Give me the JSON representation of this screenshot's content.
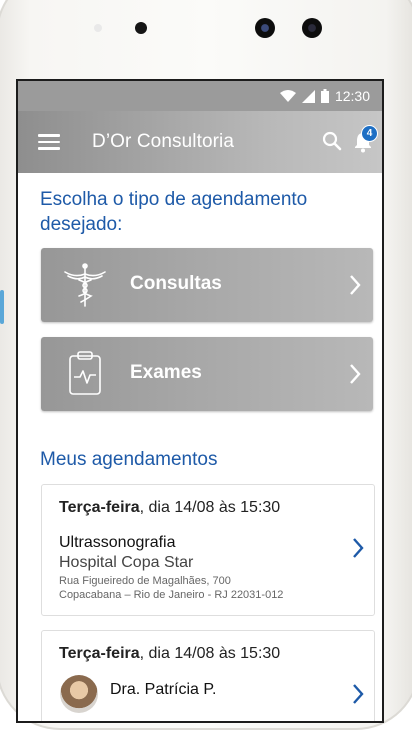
{
  "status": {
    "time": "12:30"
  },
  "appbar": {
    "title": "D’Or Consultoria",
    "notification_count": "4"
  },
  "main": {
    "heading": "Escolha o tipo de agendamento desejado:",
    "options": [
      {
        "label": "Consultas"
      },
      {
        "label": "Exames"
      }
    ],
    "section_title": "Meus agendamentos",
    "appointments": [
      {
        "day": "Terça-feira",
        "date_text": ", dia 14/08 às 15:30",
        "type": "Ultrassonografia",
        "place": "Hospital Copa Star",
        "address1": "Rua Figueiredo de Magalhães, 700",
        "address2": "Copacabana – Rio de Janeiro - RJ 22031-012"
      },
      {
        "day": "Terça-feira",
        "date_text": ", dia 14/08 às 15:30",
        "doctor": "Dra. Patrícia P."
      }
    ]
  },
  "colors": {
    "accent": "#1e5aa8",
    "badge": "#1e6fc4",
    "appbar": "#9b9b9b"
  }
}
